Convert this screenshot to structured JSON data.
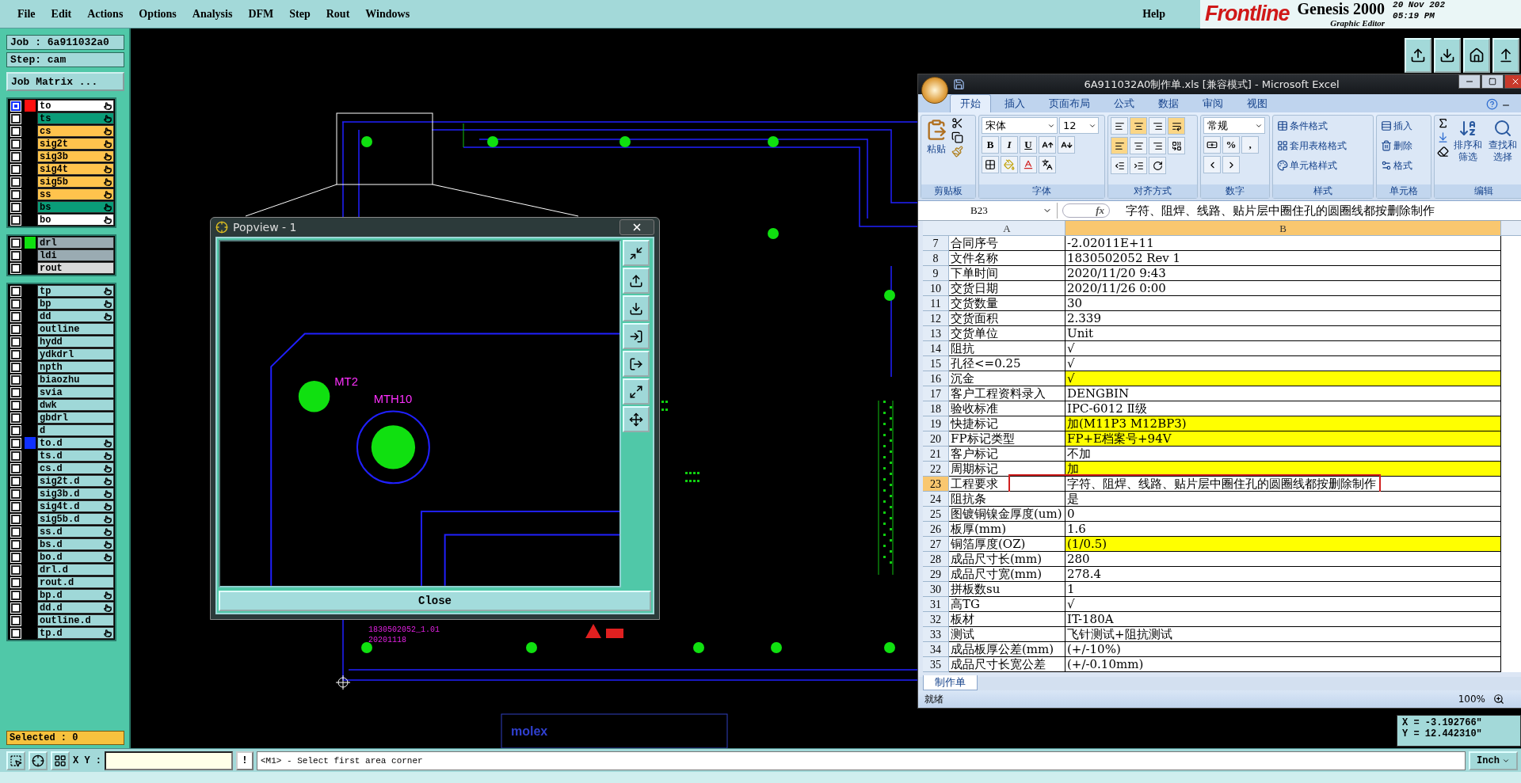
{
  "menu": {
    "items": [
      "File",
      "Edit",
      "Actions",
      "Options",
      "Analysis",
      "DFM",
      "Step",
      "Rout",
      "Windows"
    ],
    "help": "Help"
  },
  "brand": {
    "logo": "Frontline",
    "product": "Genesis 2000",
    "subtitle": "Graphic Editor",
    "date": "20 Nov 202",
    "time": "05:19 PM"
  },
  "left_panel": {
    "job": "Job : 6a911032a0",
    "step": "Step: cam",
    "matrix_button": "Job Matrix ...",
    "selected_count": "Selected : 0"
  },
  "layer_groups": [
    {
      "layers": [
        {
          "name": "to",
          "color": "#ffffff",
          "indicator": {
            "color": "#ff1010"
          },
          "affected": true,
          "selected": true
        },
        {
          "name": "ts",
          "color": "#0a9c78",
          "affected": true,
          "selected": false
        },
        {
          "name": "cs",
          "color": "#ffc34d",
          "affected": true,
          "selected": false
        },
        {
          "name": "sig2t",
          "color": "#ffc34d",
          "affected": true,
          "selected": false
        },
        {
          "name": "sig3b",
          "color": "#ffc34d",
          "affected": true,
          "selected": false
        },
        {
          "name": "sig4t",
          "color": "#ffc34d",
          "affected": true,
          "selected": false
        },
        {
          "name": "sig5b",
          "color": "#ffc34d",
          "affected": true,
          "selected": false
        },
        {
          "name": "ss",
          "color": "#ffc34d",
          "affected": true,
          "selected": false
        },
        {
          "name": "bs",
          "color": "#0a9c78",
          "affected": true,
          "selected": false
        },
        {
          "name": "bo",
          "color": "#ffffff",
          "affected": true,
          "selected": false
        }
      ]
    },
    {
      "layers": [
        {
          "name": "drl",
          "color": "#9aabb2",
          "indicator": {
            "color": "#10e010"
          },
          "affected": false,
          "selected": false
        },
        {
          "name": "ldi",
          "color": "#9aabb2",
          "affected": false,
          "selected": false
        },
        {
          "name": "rout",
          "color": "#d9d9d9",
          "affected": false,
          "selected": false
        }
      ]
    },
    {
      "layers": [
        {
          "name": "tp",
          "color": "#9fd8d8",
          "affected": true,
          "selected": false
        },
        {
          "name": "bp",
          "color": "#9fd8d8",
          "affected": true,
          "selected": false
        },
        {
          "name": "dd",
          "color": "#9fd8d8",
          "affected": true,
          "selected": false
        },
        {
          "name": "outline",
          "color": "#9fd8d8",
          "affected": false,
          "selected": false
        },
        {
          "name": "hydd",
          "color": "#9fd8d8",
          "affected": false,
          "selected": false
        },
        {
          "name": "ydkdrl",
          "color": "#9fd8d8",
          "affected": false,
          "selected": false
        },
        {
          "name": "npth",
          "color": "#9fd8d8",
          "affected": false,
          "selected": false
        },
        {
          "name": "biaozhu",
          "color": "#9fd8d8",
          "affected": false,
          "selected": false
        },
        {
          "name": "svia",
          "color": "#9fd8d8",
          "affected": false,
          "selected": false
        },
        {
          "name": "dwk",
          "color": "#9fd8d8",
          "affected": false,
          "selected": false
        },
        {
          "name": "gbdrl",
          "color": "#9fd8d8",
          "affected": false,
          "selected": false
        },
        {
          "name": "d",
          "color": "#9fd8d8",
          "affected": false,
          "selected": false
        },
        {
          "name": "to.d",
          "color": "#9fd8d8",
          "indicator": {
            "color": "#1030ff"
          },
          "affected": true,
          "selected": false
        },
        {
          "name": "ts.d",
          "color": "#9fd8d8",
          "affected": true,
          "selected": false
        },
        {
          "name": "cs.d",
          "color": "#9fd8d8",
          "affected": true,
          "selected": false
        },
        {
          "name": "sig2t.d",
          "color": "#9fd8d8",
          "affected": true,
          "selected": false
        },
        {
          "name": "sig3b.d",
          "color": "#9fd8d8",
          "affected": true,
          "selected": false
        },
        {
          "name": "sig4t.d",
          "color": "#9fd8d8",
          "affected": true,
          "selected": false
        },
        {
          "name": "sig5b.d",
          "color": "#9fd8d8",
          "affected": true,
          "selected": false
        },
        {
          "name": "ss.d",
          "color": "#9fd8d8",
          "affected": true,
          "selected": false
        },
        {
          "name": "bs.d",
          "color": "#9fd8d8",
          "affected": true,
          "selected": false
        },
        {
          "name": "bo.d",
          "color": "#9fd8d8",
          "affected": true,
          "selected": false
        },
        {
          "name": "drl.d",
          "color": "#9fd8d8",
          "affected": false,
          "selected": false
        },
        {
          "name": "rout.d",
          "color": "#9fd8d8",
          "affected": false,
          "selected": false
        },
        {
          "name": "bp.d",
          "color": "#9fd8d8",
          "affected": true,
          "selected": false
        },
        {
          "name": "dd.d",
          "color": "#9fd8d8",
          "affected": true,
          "selected": false
        },
        {
          "name": "outline.d",
          "color": "#9fd8d8",
          "affected": false,
          "selected": false
        },
        {
          "name": "tp.d",
          "color": "#9fd8d8",
          "affected": true,
          "selected": false
        }
      ]
    }
  ],
  "canvas": {
    "board_labels": [
      "1830502052_1.01",
      "20201118"
    ],
    "title_block_logo": "molex"
  },
  "popview": {
    "title": "Popview - 1",
    "close_button": "Close",
    "labels": [
      "MT2",
      "MTH10"
    ]
  },
  "excel": {
    "title": "6A911032A0制作单.xls  [兼容模式] - Microsoft Excel",
    "tabs": [
      {
        "label": "开始",
        "selected": true
      },
      {
        "label": "插入",
        "selected": false
      },
      {
        "label": "页面布局",
        "selected": false
      },
      {
        "label": "公式",
        "selected": false
      },
      {
        "label": "数据",
        "selected": false
      },
      {
        "label": "审阅",
        "selected": false
      },
      {
        "label": "视图",
        "selected": false
      }
    ],
    "ribbon": {
      "clipboard": {
        "label": "剪贴板",
        "paste": "粘贴"
      },
      "font": {
        "label": "字体",
        "font_name": "宋体",
        "font_size": "12",
        "styles": [
          "B",
          "I",
          "U"
        ]
      },
      "alignment": {
        "label": "对齐方式"
      },
      "number": {
        "label": "数字",
        "format": "常规",
        "symbols": [
          "%",
          ","
        ]
      },
      "styles": {
        "label": "样式",
        "buttons": [
          "条件格式",
          "套用表格格式",
          "单元格样式"
        ]
      },
      "cells": {
        "label": "单元格",
        "buttons": [
          "插入",
          "删除",
          "格式"
        ]
      },
      "editing": {
        "label": "编辑",
        "buttons": [
          "排序和筛选",
          "查找和选择"
        ]
      }
    },
    "name_box": "B23",
    "function_label": "fx",
    "formula": "字符、阻焊、线路、贴片层中圈住孔的圆圈线都按删除制作",
    "columns": [
      "A",
      "B"
    ],
    "rows": [
      {
        "row": "7",
        "a": "合同序号",
        "b": "-2.02011E+11",
        "highlight": false,
        "selected": false,
        "boxed": false
      },
      {
        "row": "8",
        "a": "文件名称",
        "b": "1830502052 Rev 1",
        "highlight": false,
        "selected": false,
        "boxed": false
      },
      {
        "row": "9",
        "a": "下单时间",
        "b": "2020/11/20 9:43",
        "highlight": false,
        "selected": false,
        "boxed": false
      },
      {
        "row": "10",
        "a": "交货日期",
        "b": "2020/11/26 0:00",
        "highlight": false,
        "selected": false,
        "boxed": false
      },
      {
        "row": "11",
        "a": "交货数量",
        "b": "30",
        "highlight": false,
        "selected": false,
        "boxed": false
      },
      {
        "row": "12",
        "a": "交货面积",
        "b": "2.339",
        "highlight": false,
        "selected": false,
        "boxed": false
      },
      {
        "row": "13",
        "a": "交货单位",
        "b": "Unit",
        "highlight": false,
        "selected": false,
        "boxed": false
      },
      {
        "row": "14",
        "a": "阻抗",
        "b": "√",
        "highlight": false,
        "selected": false,
        "boxed": false
      },
      {
        "row": "15",
        "a": "孔径<=0.25",
        "b": "√",
        "highlight": false,
        "selected": false,
        "boxed": false
      },
      {
        "row": "16",
        "a": "沉金",
        "b": "√",
        "highlight": true,
        "selected": false,
        "boxed": false
      },
      {
        "row": "17",
        "a": "客户工程资料录入",
        "b": "DENGBIN",
        "highlight": false,
        "selected": false,
        "boxed": false
      },
      {
        "row": "18",
        "a": "验收标准",
        "b": "IPC-6012 Ⅱ级",
        "highlight": false,
        "selected": false,
        "boxed": false
      },
      {
        "row": "19",
        "a": "快捷标记",
        "b": "加(M11P3 M12BP3)",
        "highlight": true,
        "selected": false,
        "boxed": false
      },
      {
        "row": "20",
        "a": "FP标记类型",
        "b": "FP+E档案号+94V",
        "highlight": true,
        "selected": false,
        "boxed": false
      },
      {
        "row": "21",
        "a": "客户标记",
        "b": "不加",
        "highlight": false,
        "selected": false,
        "boxed": false
      },
      {
        "row": "22",
        "a": "周期标记",
        "b": "加",
        "highlight": true,
        "selected": false,
        "boxed": false
      },
      {
        "row": "23",
        "a": "工程要求",
        "b": "字符、阻焊、线路、贴片层中圈住孔的圆圈线都按删除制作",
        "highlight": false,
        "selected": true,
        "boxed": true
      },
      {
        "row": "24",
        "a": "阻抗条",
        "b": "是",
        "highlight": false,
        "selected": false,
        "boxed": false
      },
      {
        "row": "25",
        "a": "图镀铜镍金厚度(um)",
        "b": "0",
        "highlight": false,
        "selected": false,
        "boxed": false
      },
      {
        "row": "26",
        "a": "板厚(mm)",
        "b": "1.6",
        "highlight": false,
        "selected": false,
        "boxed": false
      },
      {
        "row": "27",
        "a": "铜箔厚度(OZ)",
        "b": " (1/0.5)",
        "highlight": true,
        "selected": false,
        "boxed": false
      },
      {
        "row": "28",
        "a": "成品尺寸长(mm)",
        "b": "280",
        "highlight": false,
        "selected": false,
        "boxed": false
      },
      {
        "row": "29",
        "a": "成品尺寸宽(mm)",
        "b": "278.4",
        "highlight": false,
        "selected": false,
        "boxed": false
      },
      {
        "row": "30",
        "a": "拼板数su",
        "b": "1",
        "highlight": false,
        "selected": false,
        "boxed": false
      },
      {
        "row": "31",
        "a": "高TG",
        "b": "√",
        "highlight": false,
        "selected": false,
        "boxed": false
      },
      {
        "row": "32",
        "a": "板材",
        "b": "IT-180A",
        "highlight": false,
        "selected": false,
        "boxed": false
      },
      {
        "row": "33",
        "a": "测试",
        "b": "飞针测试+阻抗测试",
        "highlight": false,
        "selected": false,
        "boxed": false
      },
      {
        "row": "34",
        "a": "成品板厚公差(mm)",
        "b": "(+/-10%)",
        "highlight": false,
        "selected": false,
        "boxed": false
      },
      {
        "row": "35",
        "a": "成品尺寸长宽公差",
        "b": "(+/-0.10mm)",
        "highlight": false,
        "selected": false,
        "boxed": false
      }
    ],
    "sheet_tab": "制作单",
    "status": "就绪",
    "zoom": "100%"
  },
  "bottom_bar": {
    "xy_label": "X Y :",
    "alert_button": "!",
    "message": "<M1> - Select first area corner",
    "units": "Inch"
  },
  "coordinates": {
    "x": "X = -3.192766\"",
    "y": "Y = 12.442310\""
  }
}
